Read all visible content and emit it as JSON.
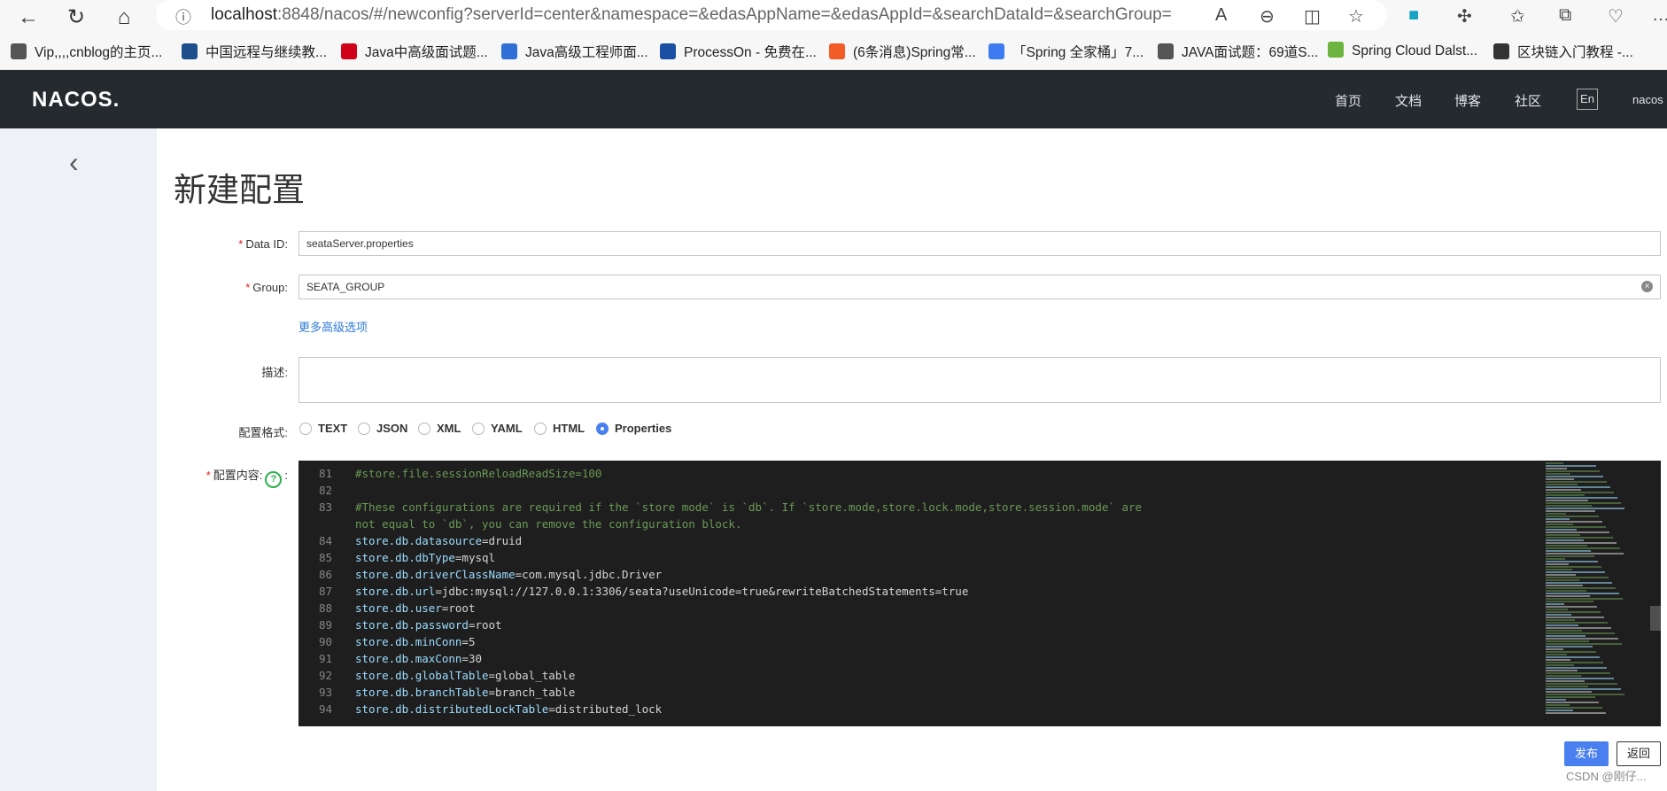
{
  "browser": {
    "url_main": "localhost",
    "url_rest": ":8848/nacos/#/newconfig?serverId=center&namespace=&edasAppName=&edasAppId=&searchDataId=&searchGroup=",
    "bookmarks": [
      {
        "label": "Vip,,,,cnblog的主页...",
        "icon_color": "#555555"
      },
      {
        "label": "中国远程与继续教...",
        "icon_color": "#1f4e8c"
      },
      {
        "label": "Java中高级面试题...",
        "icon_color": "#d0021b"
      },
      {
        "label": "Java高级工程师面...",
        "icon_color": "#2f6fd6"
      },
      {
        "label": "ProcessOn - 免费在...",
        "icon_color": "#1a4fa3"
      },
      {
        "label": "(6条消息)Spring常...",
        "icon_color": "#f25c27"
      },
      {
        "label": "「Spring 全家桶」7...",
        "icon_color": "#3d7cf0"
      },
      {
        "label": "JAVA面试题：69道S...",
        "icon_color": "#555555"
      },
      {
        "label": "Spring Cloud Dalst...",
        "icon_color": "#6db33f"
      },
      {
        "label": "区块链入门教程 -...",
        "icon_color": "#333333"
      }
    ]
  },
  "header": {
    "logo": "NACOS.",
    "nav": [
      "首页",
      "文档",
      "博客",
      "社区"
    ],
    "lang": "En",
    "user": "nacos"
  },
  "page": {
    "title": "新建配置",
    "data_id_label": "Data ID:",
    "data_id_value": "seataServer.properties",
    "group_label": "Group:",
    "group_value": "SEATA_GROUP",
    "advanced_link": "更多高级选项",
    "desc_label": "描述:",
    "format_label": "配置格式:",
    "formats": [
      "TEXT",
      "JSON",
      "XML",
      "YAML",
      "HTML",
      "Properties"
    ],
    "selected_format": "Properties",
    "content_label": "配置内容:",
    "publish_label": "发布",
    "back_label": "返回",
    "watermark": "CSDN @刚仔..."
  },
  "editor": {
    "lines": [
      {
        "n": "81",
        "text": "#store.file.sessionReloadReadSize=100",
        "kind": "comment"
      },
      {
        "n": "82",
        "text": "",
        "kind": "comment"
      },
      {
        "n": "83",
        "text": "#These configurations are required if the `store mode` is `db`. If `store.mode,store.lock.mode,store.session.mode` are",
        "kind": "comment"
      },
      {
        "n": "",
        "text": "not equal to `db`, you can remove the configuration block.",
        "kind": "comment"
      },
      {
        "n": "84",
        "key": "store.db.datasource",
        "val": "druid",
        "kind": "kv"
      },
      {
        "n": "85",
        "key": "store.db.dbType",
        "val": "mysql",
        "kind": "kv"
      },
      {
        "n": "86",
        "key": "store.db.driverClassName",
        "val": "com.mysql.jdbc.Driver",
        "kind": "kv"
      },
      {
        "n": "87",
        "key": "store.db.url",
        "val": "jdbc:mysql://127.0.0.1:3306/seata?useUnicode=true&rewriteBatchedStatements=true",
        "kind": "kv"
      },
      {
        "n": "88",
        "key": "store.db.user",
        "val": "root",
        "kind": "kv"
      },
      {
        "n": "89",
        "key": "store.db.password",
        "val": "root",
        "kind": "kv"
      },
      {
        "n": "90",
        "key": "store.db.minConn",
        "val": "5",
        "kind": "kv"
      },
      {
        "n": "91",
        "key": "store.db.maxConn",
        "val": "30",
        "kind": "kv"
      },
      {
        "n": "92",
        "key": "store.db.globalTable",
        "val": "global_table",
        "kind": "kv"
      },
      {
        "n": "93",
        "key": "store.db.branchTable",
        "val": "branch_table",
        "kind": "kv"
      },
      {
        "n": "94",
        "key": "store.db.distributedLockTable",
        "val": "distributed_lock",
        "kind": "kv"
      }
    ]
  }
}
